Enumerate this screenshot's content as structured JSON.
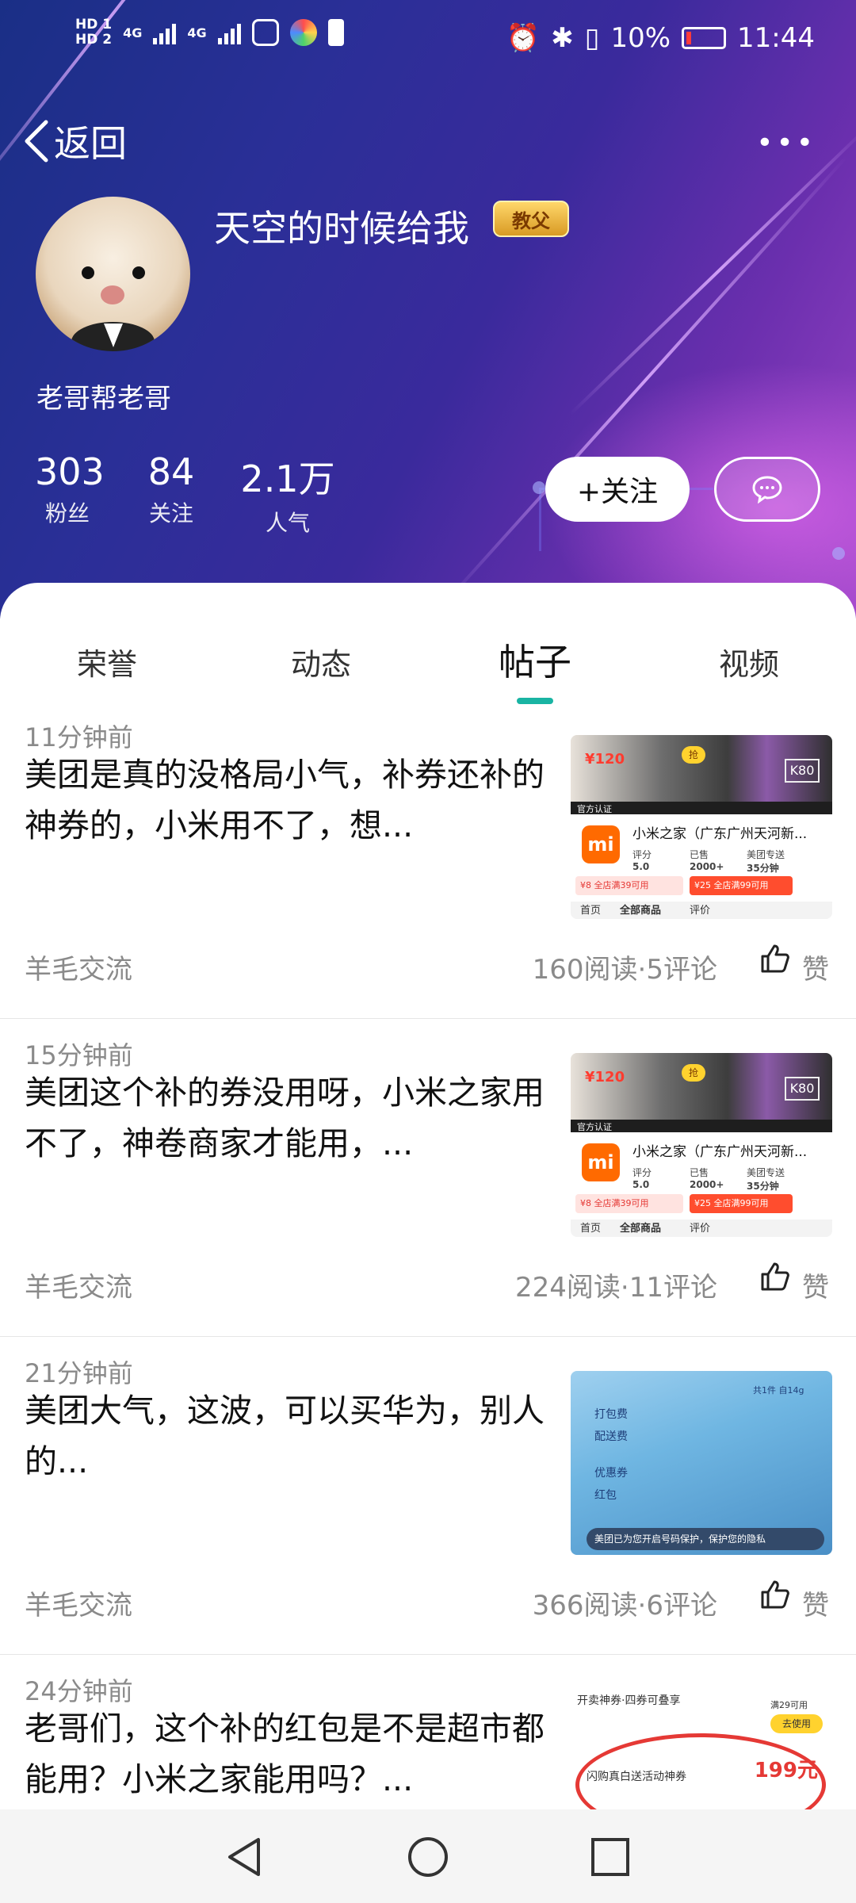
{
  "status_bar": {
    "hd1": "HD 1",
    "hd2": "HD 2",
    "net1": "4G",
    "net2": "4G",
    "battery_percent": "10%",
    "time": "11:44"
  },
  "header": {
    "back_label": "返回",
    "more_label": "•••",
    "username": "天空的时候给我",
    "badge": "教父",
    "signature": "老哥帮老哥",
    "stats": [
      {
        "value": "303",
        "label": "粉丝"
      },
      {
        "value": "84",
        "label": "关注"
      },
      {
        "value": "2.1万",
        "label": "人气"
      }
    ],
    "follow_label": "+关注"
  },
  "tabs": [
    {
      "label": "荣誉",
      "active": false
    },
    {
      "label": "动态",
      "active": false
    },
    {
      "label": "帖子",
      "active": true
    },
    {
      "label": "视频",
      "active": false
    }
  ],
  "posts": [
    {
      "time": "11分钟前",
      "title": "美团是真的没格局小气，补券还补的神券的，小米用不了，想...",
      "category": "羊毛交流",
      "meta": "160阅读·5评论",
      "like_label": "赞"
    },
    {
      "time": "15分钟前",
      "title": "美团这个补的券没用呀，小米之家用不了，神卷商家才能用，...",
      "category": "羊毛交流",
      "meta": "224阅读·11评论",
      "like_label": "赞"
    },
    {
      "time": "21分钟前",
      "title": "美团大气，这波，可以买华为，别人的...",
      "category": "羊毛交流",
      "meta": "366阅读·6评论",
      "like_label": "赞"
    },
    {
      "time": "24分钟前",
      "title": "老哥们，这个补的红包是不是超市都能用？小米之家能用吗？...",
      "category": "",
      "meta": "",
      "like_label": ""
    }
  ],
  "thumbs": {
    "shop": {
      "price": "¥120",
      "grab": "抢",
      "k80": "K80",
      "official": "官方认证",
      "name": "小米之家（广东广州天河新...",
      "score_label": "评分",
      "score": "5.0",
      "sold_label": "已售",
      "sold": "2000+",
      "delivery_label": "美团专送",
      "delivery": "35分钟",
      "coupon1": "¥8 全店满39可用",
      "coupon2": "¥25 全店满99可用",
      "nav_home": "首页",
      "nav_all": "全部商品",
      "nav_review": "评价"
    },
    "phone": {
      "line1": "共1件 自14g",
      "line2": "打包费",
      "line3": "配送费",
      "line4": "优惠券",
      "line5": "红包",
      "banner": "美团已为您开启号码保护，保护您的隐私"
    },
    "coupon": {
      "row1": "开卖神券·四券可叠享",
      "row2": "满29可用",
      "btn1": "去使用",
      "row3": "闪购真白送活动神券",
      "price": "199元"
    }
  },
  "colors": {
    "accent": "#19b4a3",
    "header_start": "#1a2f86",
    "header_end": "#9a44c6"
  }
}
